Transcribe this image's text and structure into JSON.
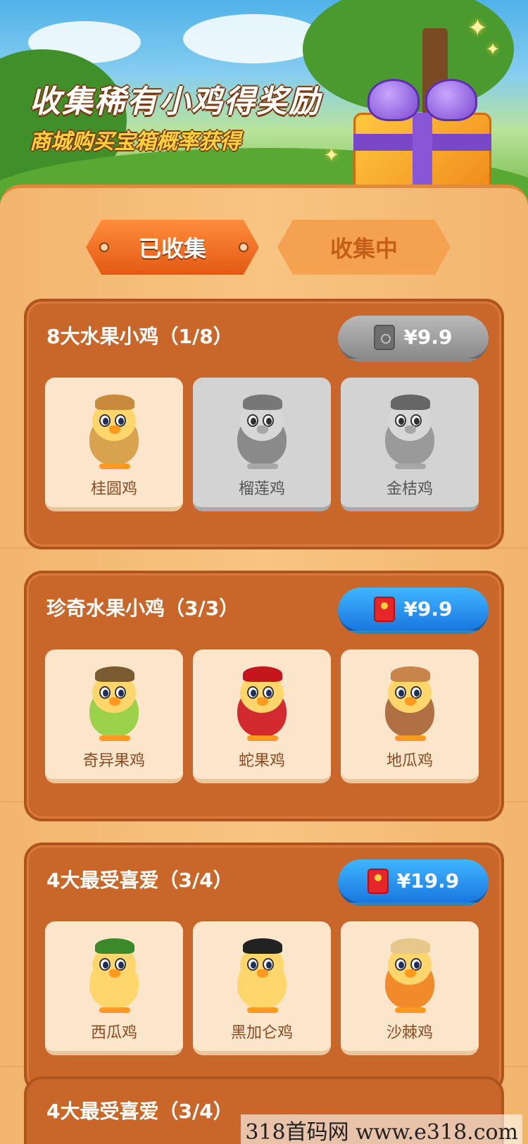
{
  "hero": {
    "title": "收集稀有小鸡得奖励",
    "subtitle": "商城购买宝箱概率获得"
  },
  "tabs": [
    {
      "label": "已收集",
      "active": true
    },
    {
      "label": "收集中",
      "active": false
    }
  ],
  "sections": [
    {
      "title": "8大水果小鸡（1/8）",
      "price": "¥9.9",
      "price_style": "gray",
      "price_icon": "safe-icon",
      "cards": [
        {
          "name": "桂圆鸡",
          "locked": false,
          "hat_color": "#c98a3c",
          "body_color": "#d8a24e"
        },
        {
          "name": "榴莲鸡",
          "locked": true,
          "hat_color": "#777777",
          "body_color": "#8a8a8a"
        },
        {
          "name": "金桔鸡",
          "locked": true,
          "hat_color": "#666666",
          "body_color": "#9a9a9a"
        }
      ]
    },
    {
      "title": "珍奇水果小鸡（3/3）",
      "price": "¥9.9",
      "price_style": "blue",
      "price_icon": "red-packet-icon",
      "cards": [
        {
          "name": "奇异果鸡",
          "locked": false,
          "hat_color": "#7a5a30",
          "body_color": "#9cd24a"
        },
        {
          "name": "蛇果鸡",
          "locked": false,
          "hat_color": "#c4161c",
          "body_color": "#d22a2e"
        },
        {
          "name": "地瓜鸡",
          "locked": false,
          "hat_color": "#c8844a",
          "body_color": "#b07044"
        }
      ]
    },
    {
      "title": "4大最受喜爱（3/4）",
      "price": "¥19.9",
      "price_style": "blue",
      "price_icon": "red-packet-icon",
      "cards": [
        {
          "name": "西瓜鸡",
          "locked": false,
          "hat_color": "#3a8a2a",
          "body_color": "#ffd66b"
        },
        {
          "name": "黑加仑鸡",
          "locked": false,
          "hat_color": "#222222",
          "body_color": "#ffd66b"
        },
        {
          "name": "沙棘鸡",
          "locked": false,
          "hat_color": "#e8c88a",
          "body_color": "#f08a2a"
        }
      ]
    }
  ],
  "partial_section": {
    "title": "4大最受喜爱（3/4）"
  },
  "watermark": "318首码网  www.e318.com"
}
